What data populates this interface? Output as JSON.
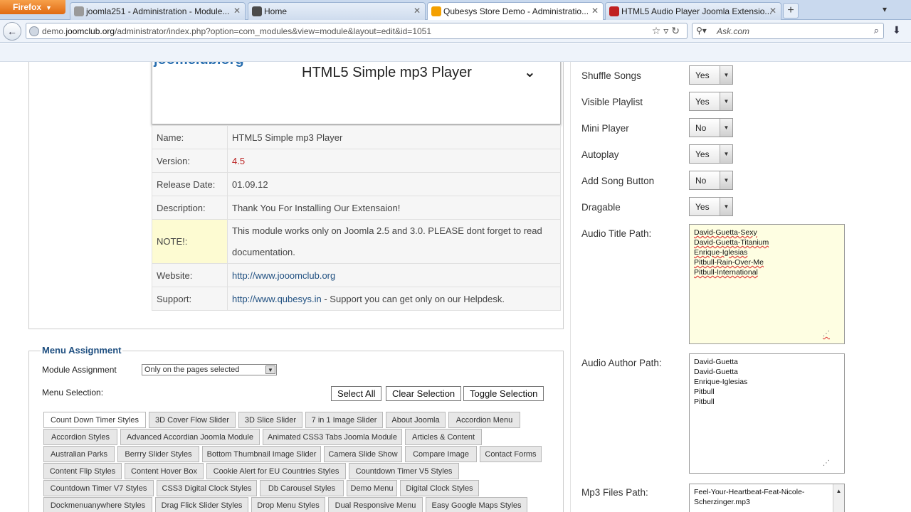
{
  "browser": {
    "menu_label": "Firefox",
    "tabs": [
      {
        "title": "joomla251 - Administration - Module...",
        "fav": "#a0a0a0"
      },
      {
        "title": "Home",
        "fav": "#4a4a4a"
      },
      {
        "title": "Qubesys Store Demo - Administratio...",
        "fav": "#f4a000"
      },
      {
        "title": "HTML5 Audio Player Joomla Extensio...",
        "fav": "#c02020"
      }
    ],
    "url_prefix": "demo.",
    "url_domain": "joomclub.org",
    "url_path": "/administrator/index.php?option=com_modules&view=module&layout=edit&id=1051",
    "search_placeholder": "Ask.com"
  },
  "module": {
    "logo_text": "joomclub.org",
    "title": "HTML5 Simple mp3 Player",
    "info": {
      "name_label": "Name:",
      "name": "HTML5 Simple mp3 Player",
      "version_label": "Version:",
      "version": "4.5",
      "release_label": "Release Date:",
      "release": "01.09.12",
      "desc_label": "Description:",
      "desc": "Thank You For Installing Our Extensaion!",
      "note_label": "NOTE!:",
      "note": "This module works only on Joomla 2.5 and 3.0. PLEASE dont forget to read documentation.",
      "website_label": "Website:",
      "website": "http://www.jooomclub.org",
      "support_label": "Support:",
      "support_link": "http://www.qubesys.in",
      "support_text": " - Support you can get only on our Helpdesk."
    }
  },
  "menu_assignment": {
    "legend": "Menu Assignment",
    "module_assignment_label": "Module Assignment",
    "module_assignment_value": "Only on the pages selected",
    "menu_selection_label": "Menu Selection:",
    "select_all": "Select All",
    "clear_selection": "Clear Selection",
    "toggle_selection": "Toggle Selection",
    "chips": [
      [
        "Count Down Timer Styles",
        "3D Cover Flow Slider",
        "3D Slice Slider",
        "7 in 1 Image Slider",
        "About Joomla",
        "Accordion Menu"
      ],
      [
        "Accordion Styles",
        "Advanced Accordian Joomla Module",
        "Animated CSS3 Tabs Joomla Module",
        "Articles & Content"
      ],
      [
        "Australian Parks",
        "Berrry Slider Styles",
        "Bottom Thumbnail Image Slider",
        "Camera Slide Show",
        "Compare Image",
        "Contact Forms"
      ],
      [
        "Content Flip Styles",
        "Content Hover Box",
        "Cookie Alert for EU Countries Styles",
        "Countdown Timer V5 Styles"
      ],
      [
        "Countdown Timer V7 Styles",
        "CSS3 Digital Clock Styles",
        "Db Carousel Styles",
        "Demo Menu",
        "Digital Clock Styles"
      ],
      [
        "Dockmenuanywhere Styles",
        "Drag Flick Slider Styles",
        "Drop Menu Styles",
        "Dual Responsive Menu",
        "Easy Google Maps Styles"
      ]
    ]
  },
  "options": {
    "shuffle_label": "Shuffle Songs",
    "shuffle": "Yes",
    "playlist_label": "Visible Playlist",
    "playlist": "Yes",
    "mini_label": "Mini Player",
    "mini": "No",
    "autoplay_label": "Autoplay",
    "autoplay": "Yes",
    "addsong_label": "Add Song Button",
    "addsong": "No",
    "drag_label": "Dragable",
    "drag": "Yes",
    "title_path_label": "Audio Title Path:",
    "title_path": [
      "David-Guetta-Sexy",
      "David-Guetta-Titanium",
      "Enrique-Iglesias",
      "Pitbull-Rain-Over-Me",
      "Pitbull-International"
    ],
    "author_path_label": "Audio Author Path:",
    "author_path": [
      "David-Guetta",
      "David-Guetta",
      "Enrique-Iglesias",
      "Pitbull",
      "Pitbull"
    ],
    "mp3_path_label": "Mp3 Files Path:",
    "mp3_path": [
      "Feel-Your-Heartbeat-Feat-Nicole-",
      "Scherzinger.mp3"
    ]
  }
}
